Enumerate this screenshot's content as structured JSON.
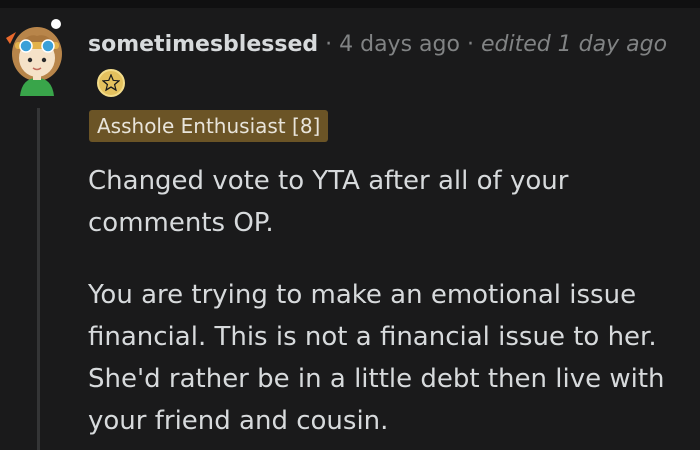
{
  "comment": {
    "username": "sometimesblessed",
    "separator": "·",
    "posted": "4 days ago",
    "edited": "edited 1 day ago",
    "flair": "Asshole Enthusiast [8]",
    "paragraphs": [
      "Changed vote to YTA after all of your comments OP.",
      "You are trying to make an emotional issue financial. This is not a financial issue to her. She'd rather be in a little debt then live with your friend and cousin."
    ]
  },
  "icons": {
    "avatar": "user-avatar",
    "award": "star-award-icon"
  }
}
